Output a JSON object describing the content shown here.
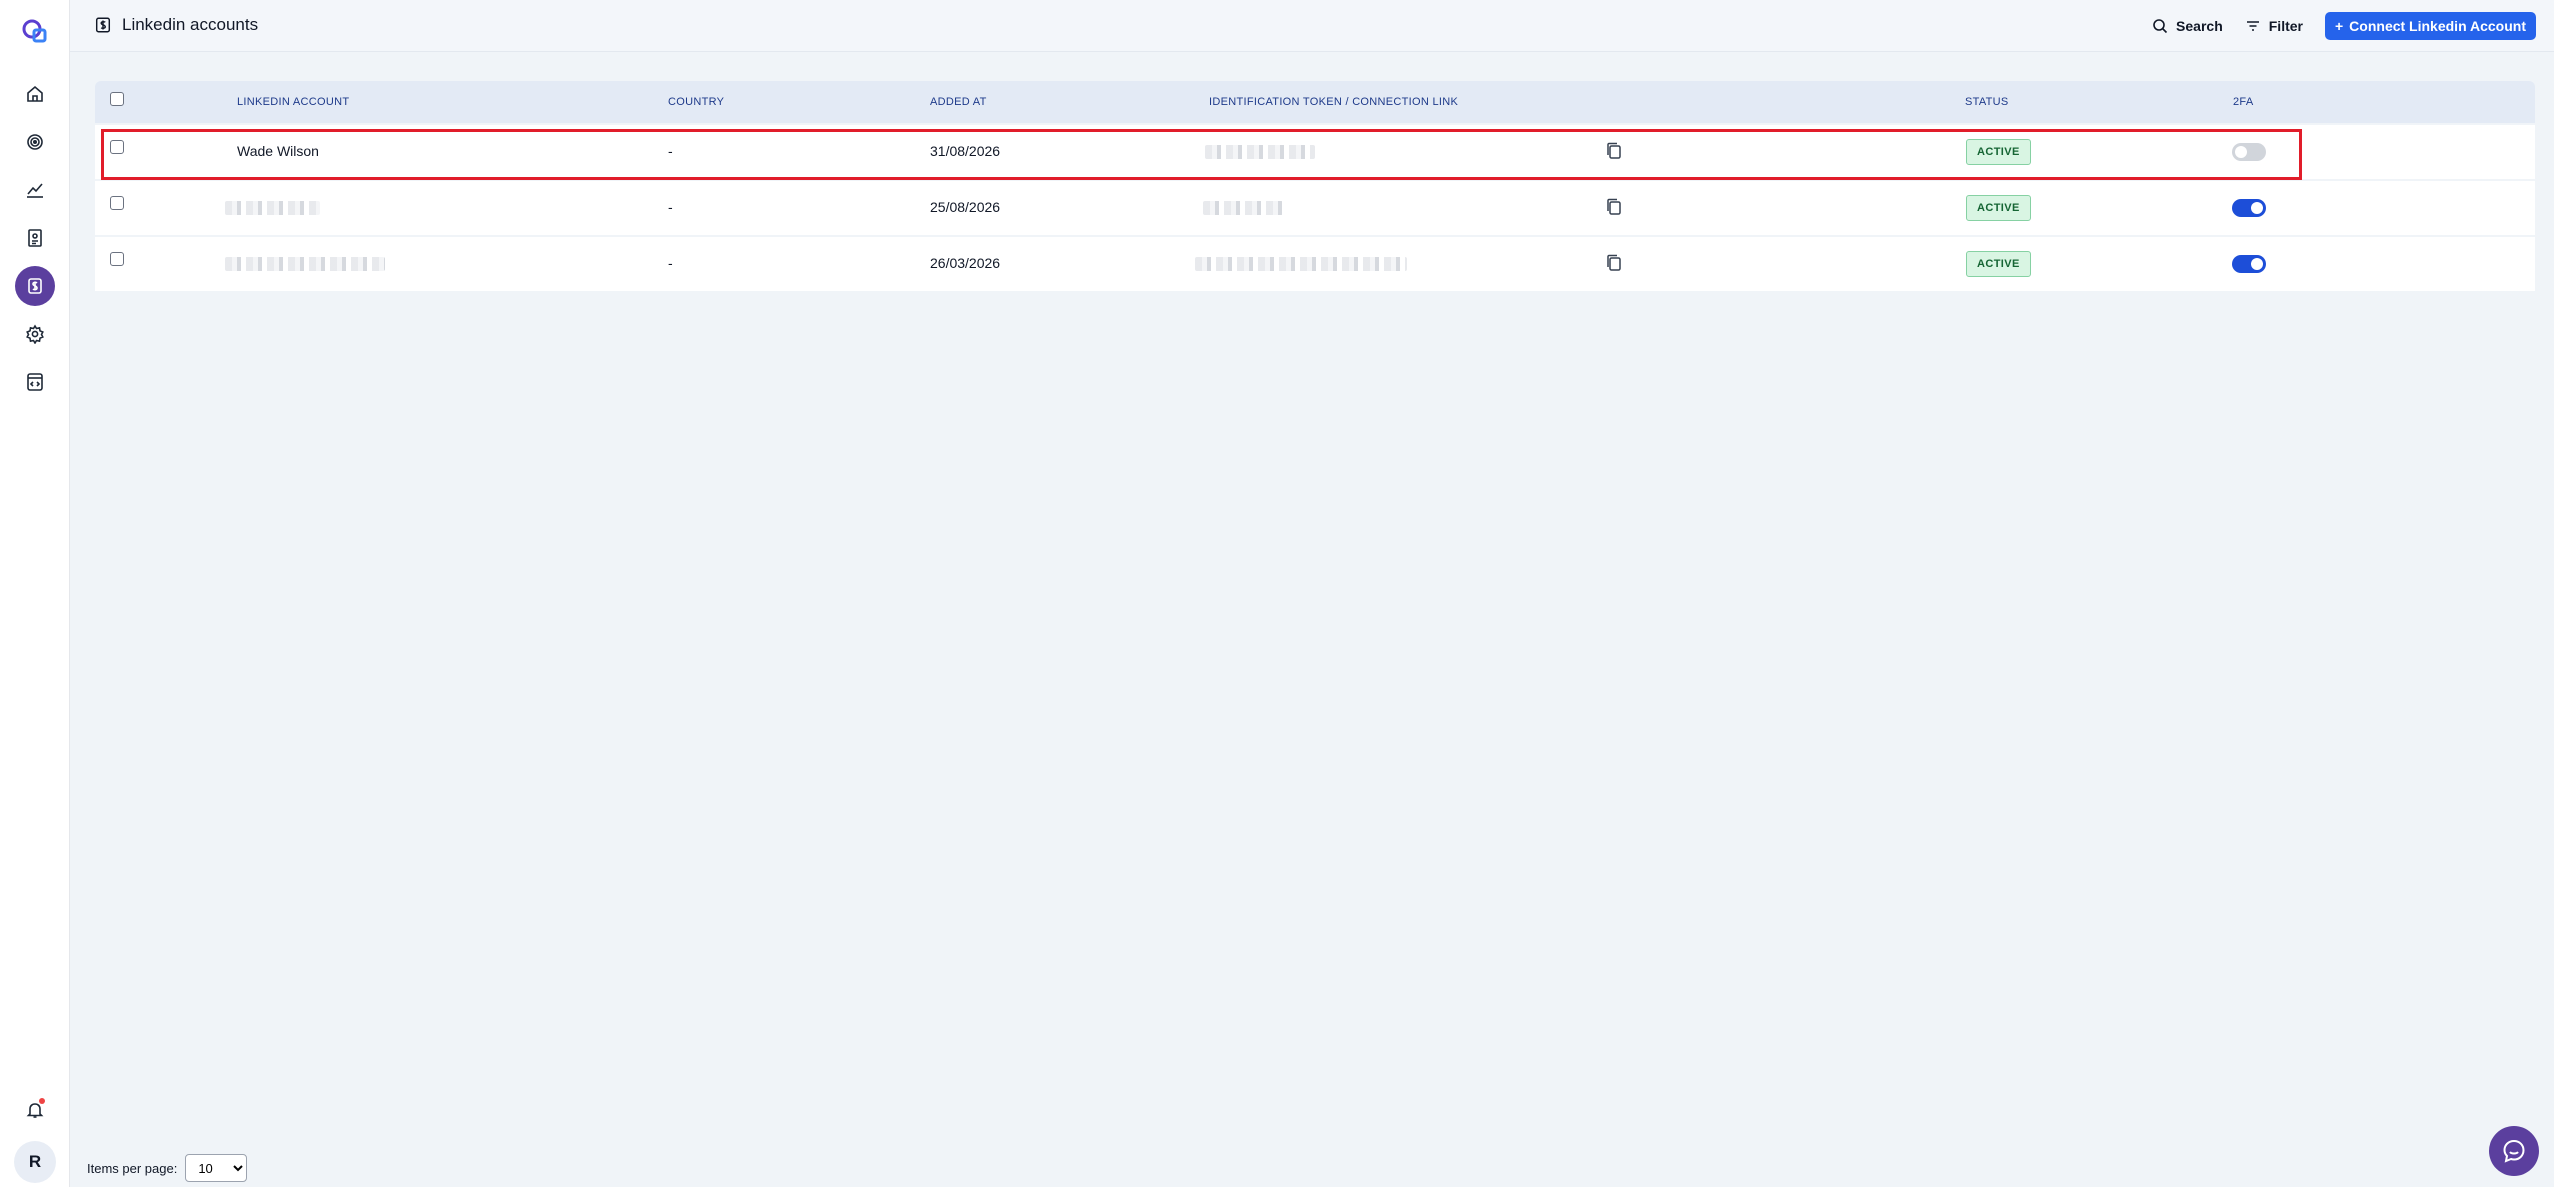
{
  "header": {
    "title": "Linkedin accounts",
    "search_label": "Search",
    "filter_label": "Filter",
    "connect_label": "Connect Linkedin Account"
  },
  "table": {
    "columns": [
      "LINKEDIN ACCOUNT",
      "COUNTRY",
      "ADDED AT",
      "IDENTIFICATION TOKEN / CONNECTION LINK",
      "STATUS",
      "2FA"
    ],
    "rows": [
      {
        "account": "Wade Wilson",
        "country": "-",
        "added_at": "31/08/2026",
        "status": "ACTIVE",
        "two_fa": false,
        "account_redacted": false
      },
      {
        "account": "",
        "country": "-",
        "added_at": "25/08/2026",
        "status": "ACTIVE",
        "two_fa": true,
        "account_redacted": true
      },
      {
        "account": "",
        "country": "-",
        "added_at": "26/03/2026",
        "status": "ACTIVE",
        "two_fa": true,
        "account_redacted": true
      }
    ]
  },
  "footer": {
    "items_per_page_label": "Items per page:",
    "items_per_page_value": "10"
  },
  "sidebar": {
    "user_initial": "R",
    "items": [
      "home-icon",
      "target-icon",
      "chart-line-icon",
      "document-icon",
      "dollar-icon",
      "gear-icon",
      "code-file-icon"
    ]
  },
  "colors": {
    "accent": "#2563eb",
    "active_nav": "#5b3f9e",
    "status_active_bg": "#d9f5e3",
    "highlight": "#e11d2a"
  }
}
